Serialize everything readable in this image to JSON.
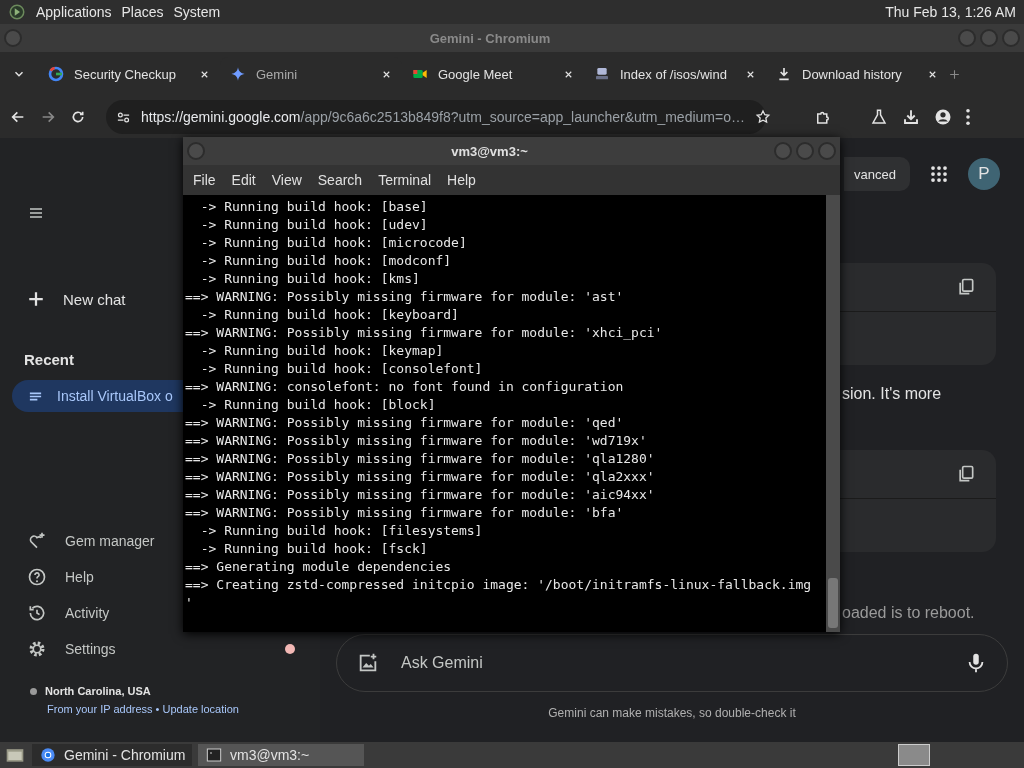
{
  "top_panel": {
    "menus": [
      "Applications",
      "Places",
      "System"
    ],
    "clock": "Thu Feb 13, 1:26 AM"
  },
  "browser": {
    "title": "Gemini - Chromium",
    "tabs": [
      {
        "label": "Security Checkup",
        "kind": "google",
        "selected": false
      },
      {
        "label": "Gemini",
        "kind": "gemini",
        "selected": true
      },
      {
        "label": "Google Meet",
        "kind": "meet",
        "selected": false
      },
      {
        "label": "Index of /isos/wind",
        "kind": "server",
        "selected": false
      },
      {
        "label": "Download history",
        "kind": "download",
        "selected": false
      }
    ],
    "url_host": "https://gemini.google.com",
    "url_path": "/app/9c6a6c2513b849f8?utm_source=app_launcher&utm_medium=o…"
  },
  "gemini": {
    "sidebar": {
      "new_chat": "New chat",
      "recent_heading": "Recent",
      "recent": [
        {
          "label": "Install VirtualBox o",
          "selected": true
        }
      ],
      "items": [
        {
          "label": "Gem manager",
          "kind": "gem",
          "notification": false
        },
        {
          "label": "Help",
          "kind": "help",
          "notification": false
        },
        {
          "label": "Activity",
          "kind": "activity",
          "notification": false
        },
        {
          "label": "Settings",
          "kind": "settings",
          "notification": true
        }
      ],
      "location": "North Carolina, USA",
      "location_note": "From your IP address •",
      "update_link": "Update location"
    },
    "upgrade_button": "vanced",
    "avatar": "P",
    "response_fragments": [
      "sion. It's more",
      "oaded is to reboot."
    ],
    "input_placeholder": "Ask Gemini",
    "disclaimer": "Gemini can make mistakes, so double-check it"
  },
  "terminal": {
    "title": "vm3@vm3:~",
    "menus": [
      "File",
      "Edit",
      "View",
      "Search",
      "Terminal",
      "Help"
    ],
    "lines": [
      "  -> Running build hook: [base]",
      "  -> Running build hook: [udev]",
      "  -> Running build hook: [microcode]",
      "  -> Running build hook: [modconf]",
      "  -> Running build hook: [kms]",
      "==> WARNING: Possibly missing firmware for module: 'ast'",
      "  -> Running build hook: [keyboard]",
      "==> WARNING: Possibly missing firmware for module: 'xhci_pci'",
      "  -> Running build hook: [keymap]",
      "  -> Running build hook: [consolefont]",
      "==> WARNING: consolefont: no font found in configuration",
      "  -> Running build hook: [block]",
      "==> WARNING: Possibly missing firmware for module: 'qed'",
      "==> WARNING: Possibly missing firmware for module: 'wd719x'",
      "==> WARNING: Possibly missing firmware for module: 'qla1280'",
      "==> WARNING: Possibly missing firmware for module: 'qla2xxx'",
      "==> WARNING: Possibly missing firmware for module: 'aic94xx'",
      "==> WARNING: Possibly missing firmware for module: 'bfa'",
      "  -> Running build hook: [filesystems]",
      "  -> Running build hook: [fsck]",
      "==> Generating module dependencies",
      "==> Creating zstd-compressed initcpio image: '/boot/initramfs-linux-fallback.img",
      "'"
    ]
  },
  "taskbar": {
    "items": [
      {
        "label": "Gemini - Chromium",
        "kind": "browser"
      },
      {
        "label": "vm3@vm3:~",
        "kind": "terminal"
      }
    ]
  }
}
